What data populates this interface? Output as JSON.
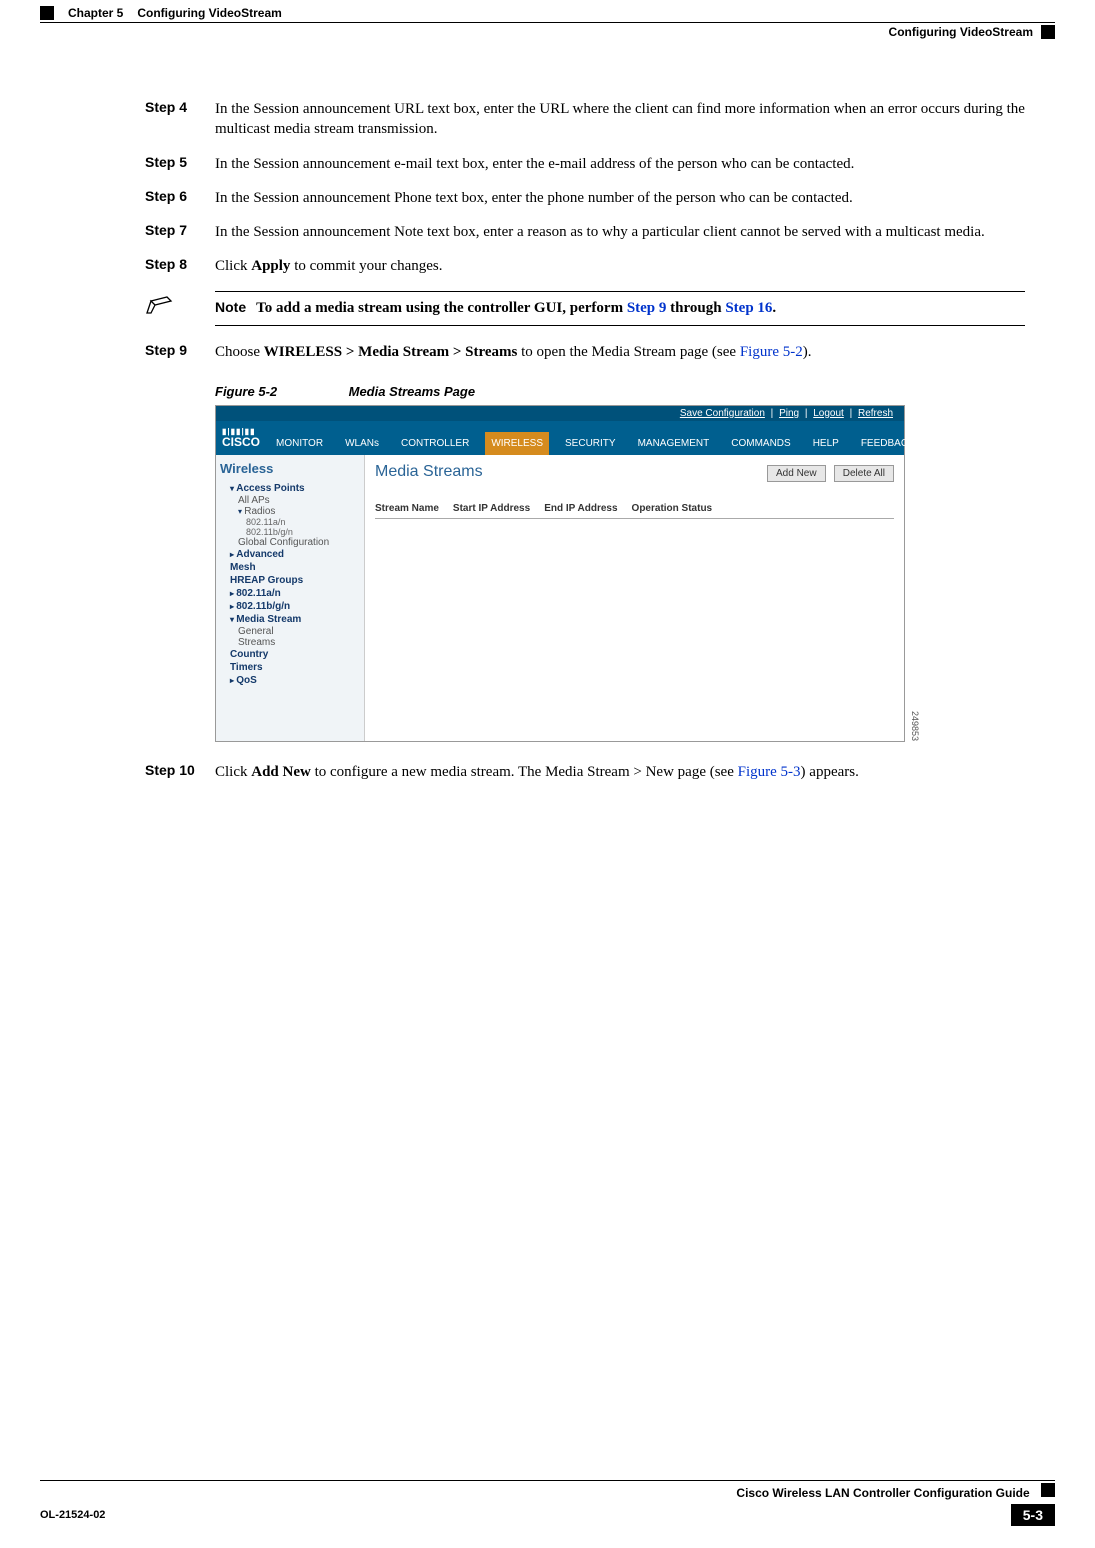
{
  "header": {
    "chapter": "Chapter 5",
    "title": "Configuring VideoStream",
    "section": "Configuring VideoStream"
  },
  "steps": {
    "s4": {
      "label": "Step 4",
      "text": "In the Session announcement URL text box, enter the URL where the client can find more information when an error occurs during the multicast media stream transmission."
    },
    "s5": {
      "label": "Step 5",
      "text": "In the Session announcement e-mail text box, enter the e-mail address of the person who can be contacted."
    },
    "s6": {
      "label": "Step 6",
      "text": "In the Session announcement Phone text box, enter the phone number of the person who can be contacted."
    },
    "s7": {
      "label": "Step 7",
      "text": "In the Session announcement Note text box, enter a reason as to why a particular client cannot be served with a multicast media."
    },
    "s8": {
      "label": "Step 8",
      "pre": "Click ",
      "bold": "Apply",
      "post": " to commit your changes."
    },
    "s9": {
      "label": "Step 9",
      "pre": "Choose ",
      "bold": "WIRELESS > Media Stream > Streams",
      "mid": " to open the Media Stream page (see ",
      "link": "Figure 5-2",
      "post": ")."
    },
    "s10": {
      "label": "Step 10",
      "pre": "Click ",
      "bold": "Add New",
      "mid": " to configure a new media stream. The Media Stream > New page (see ",
      "link": "Figure 5-3",
      "post": ") appears."
    }
  },
  "note": {
    "label": "Note",
    "pre": "To add a media stream using the controller GUI, perform ",
    "link1": "Step 9",
    "mid": " through ",
    "link2": "Step 16",
    "post": "."
  },
  "figure": {
    "no": "Figure 5-2",
    "title": "Media Streams Page",
    "id": "249853"
  },
  "screenshot": {
    "brand": "CISCO",
    "topbar": {
      "save": "Save Configuration",
      "ping": "Ping",
      "logout": "Logout",
      "refresh": "Refresh"
    },
    "menu": {
      "monitor": "MONITOR",
      "wlans": "WLANs",
      "controller": "CONTROLLER",
      "wireless": "WIRELESS",
      "security": "SECURITY",
      "management": "MANAGEMENT",
      "commands": "COMMANDS",
      "help": "HELP",
      "feedback": "FEEDBACK"
    },
    "sidebar": {
      "title": "Wireless",
      "ap": "Access Points",
      "allaps": "All APs",
      "radios": "Radios",
      "r11a": "802.11a/n",
      "r11b": "802.11b/g/n",
      "global": "Global Configuration",
      "advanced": "Advanced",
      "mesh": "Mesh",
      "hreap": "HREAP Groups",
      "n11a": "802.11a/n",
      "n11b": "802.11b/g/n",
      "mediastream": "Media Stream",
      "general": "General",
      "streams": "Streams",
      "country": "Country",
      "timers": "Timers",
      "qos": "QoS"
    },
    "main": {
      "title": "Media Streams",
      "addnew": "Add New",
      "deleteall": "Delete All",
      "col1": "Stream Name",
      "col2": "Start IP Address",
      "col3": "End IP Address",
      "col4": "Operation Status"
    }
  },
  "footer": {
    "guide": "Cisco Wireless LAN Controller Configuration Guide",
    "ol": "OL-21524-02",
    "page": "5-3"
  }
}
